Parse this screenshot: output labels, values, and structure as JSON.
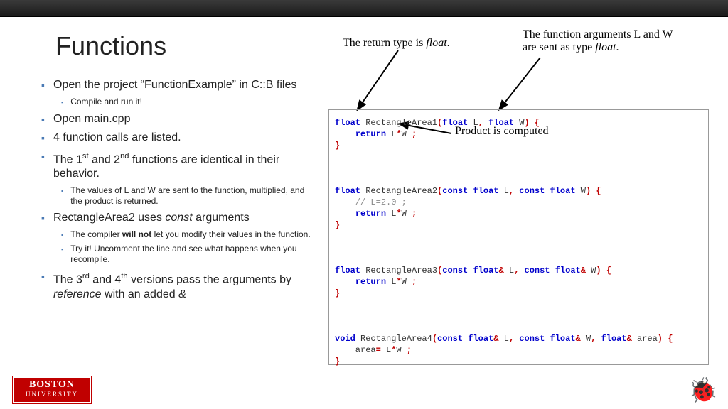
{
  "header": {
    "title": "Functions"
  },
  "bullets": [
    {
      "level": 1,
      "html": "Open the project “FunctionExample” in C::B files"
    },
    {
      "level": 2,
      "html": "Compile and run it!"
    },
    {
      "level": 1,
      "html": "Open main.cpp"
    },
    {
      "level": 1,
      "html": "4 function calls are listed."
    },
    {
      "level": 1,
      "html": "The 1<sup>st</sup> and 2<sup>nd</sup> functions are identical in their behavior."
    },
    {
      "level": 2,
      "html": "The values of L and W are sent to the function, multiplied, and the product is returned."
    },
    {
      "level": 1,
      "html": "RectangleArea2 uses <span class=\"italic\">const</span> arguments"
    },
    {
      "level": 2,
      "html": "The compiler <span class=\"bold\">will not</span> let you modify their values in the function."
    },
    {
      "level": 2,
      "html": "Try it!  Uncomment the line and see what happens when you recompile."
    },
    {
      "level": 1,
      "html": "The 3<sup>rd</sup> and 4<sup>th</sup> versions pass the arguments by <span class=\"italic\">reference</span> with an added <span class=\"italic\">&amp;</span>"
    }
  ],
  "annotations": {
    "return_type": "The return type is ",
    "return_type_it": "float",
    "return_type_end": ".",
    "args_line1": "The function arguments L and W",
    "args_line2": "are sent as type ",
    "args_it": "float",
    "args_end": ".",
    "product": "Product is computed"
  },
  "code": "<span class=\"kw\">float</span> <span class=\"fn\">RectangleArea1</span><span class=\"pn\">(</span><span class=\"kw\">float</span> L<span class=\"pn\">,</span> <span class=\"kw\">float</span> W<span class=\"pn\">)</span> <span class=\"pn\">{</span>\n    <span class=\"kw\">return</span> L<span class=\"op\">*</span>W <span class=\"pn\">;</span>\n<span class=\"pn\">}</span>\n\n\n\n<span class=\"kw\">float</span> <span class=\"fn\">RectangleArea2</span><span class=\"pn\">(</span><span class=\"kw\">const</span> <span class=\"kw\">float</span> L<span class=\"pn\">,</span> <span class=\"kw\">const</span> <span class=\"kw\">float</span> W<span class=\"pn\">)</span> <span class=\"pn\">{</span>\n    <span class=\"cm\">// L=2.0 ;</span>\n    <span class=\"kw\">return</span> L<span class=\"op\">*</span>W <span class=\"pn\">;</span>\n<span class=\"pn\">}</span>\n\n\n\n<span class=\"kw\">float</span> <span class=\"fn\">RectangleArea3</span><span class=\"pn\">(</span><span class=\"kw\">const</span> <span class=\"kw\">float</span><span class=\"op\">&amp;</span> L<span class=\"pn\">,</span> <span class=\"kw\">const</span> <span class=\"kw\">float</span><span class=\"op\">&amp;</span> W<span class=\"pn\">)</span> <span class=\"pn\">{</span>\n    <span class=\"kw\">return</span> L<span class=\"op\">*</span>W <span class=\"pn\">;</span>\n<span class=\"pn\">}</span>\n\n\n\n<span class=\"kw\">void</span> <span class=\"fn\">RectangleArea4</span><span class=\"pn\">(</span><span class=\"kw\">const</span> <span class=\"kw\">float</span><span class=\"op\">&amp;</span> L<span class=\"pn\">,</span> <span class=\"kw\">const</span> <span class=\"kw\">float</span><span class=\"op\">&amp;</span> W<span class=\"pn\">,</span> <span class=\"kw\">float</span><span class=\"op\">&amp;</span> area<span class=\"pn\">)</span> <span class=\"pn\">{</span>\n    area<span class=\"op\">=</span> L<span class=\"op\">*</span>W <span class=\"pn\">;</span>\n<span class=\"pn\">}</span>",
  "footer": {
    "logo1": "BOSTON",
    "logo2": "UNIVERSITY",
    "bug": "🐞"
  }
}
